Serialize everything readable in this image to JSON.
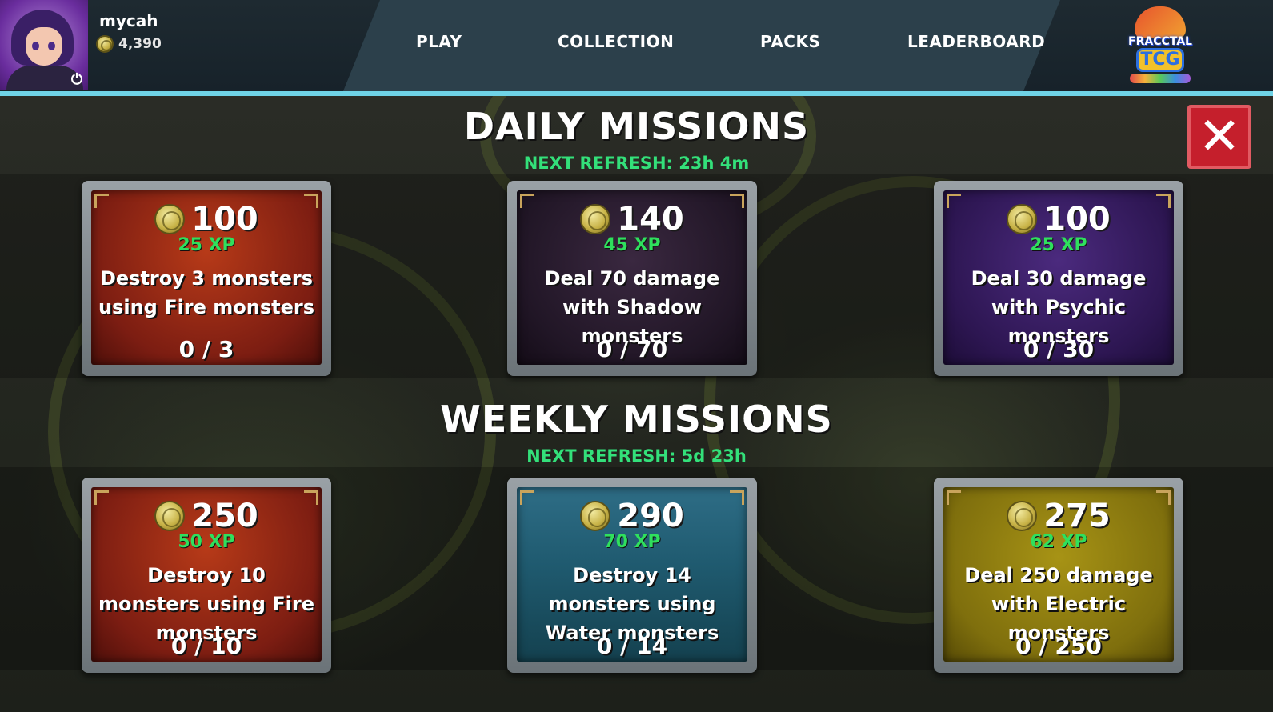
{
  "user": {
    "name": "mycah",
    "coins": "4,390"
  },
  "nav": {
    "play": "PLAY",
    "collection": "COLLECTION",
    "packs": "PACKS",
    "leaderboard": "LEADERBOARD"
  },
  "logo": {
    "line1": "FRACCTAL",
    "line2": "TCG"
  },
  "close_label": "✕",
  "daily": {
    "title": "DAILY MISSIONS",
    "refresh": "NEXT REFRESH: 23h 4m",
    "missions": [
      {
        "reward": "100",
        "xp": "25 XP",
        "text": "Destroy 3 monsters using Fire monsters",
        "progress": "0 / 3",
        "theme": "fire"
      },
      {
        "reward": "140",
        "xp": "45 XP",
        "text": "Deal 70 damage with Shadow monsters",
        "progress": "0 / 70",
        "theme": "shadow"
      },
      {
        "reward": "100",
        "xp": "25 XP",
        "text": "Deal 30 damage with Psychic monsters",
        "progress": "0 / 30",
        "theme": "psychic"
      }
    ]
  },
  "weekly": {
    "title": "WEEKLY MISSIONS",
    "refresh": "NEXT REFRESH: 5d 23h",
    "missions": [
      {
        "reward": "250",
        "xp": "50 XP",
        "text": "Destroy 10 monsters using Fire monsters",
        "progress": "0 / 10",
        "theme": "fire"
      },
      {
        "reward": "290",
        "xp": "70 XP",
        "text": "Destroy 14 monsters using Water monsters",
        "progress": "0 / 14",
        "theme": "water"
      },
      {
        "reward": "275",
        "xp": "62 XP",
        "text": "Deal 250 damage with Electric monsters",
        "progress": "0 / 250",
        "theme": "electric"
      }
    ]
  },
  "colors": {
    "accent_line": "#6fd3e6",
    "refresh_green": "#33e07a",
    "xp_green": "#2fe05d",
    "close_red": "#c51f2c"
  },
  "icons": {
    "coin": "coin-icon",
    "power": "power-icon",
    "close": "close-icon"
  }
}
